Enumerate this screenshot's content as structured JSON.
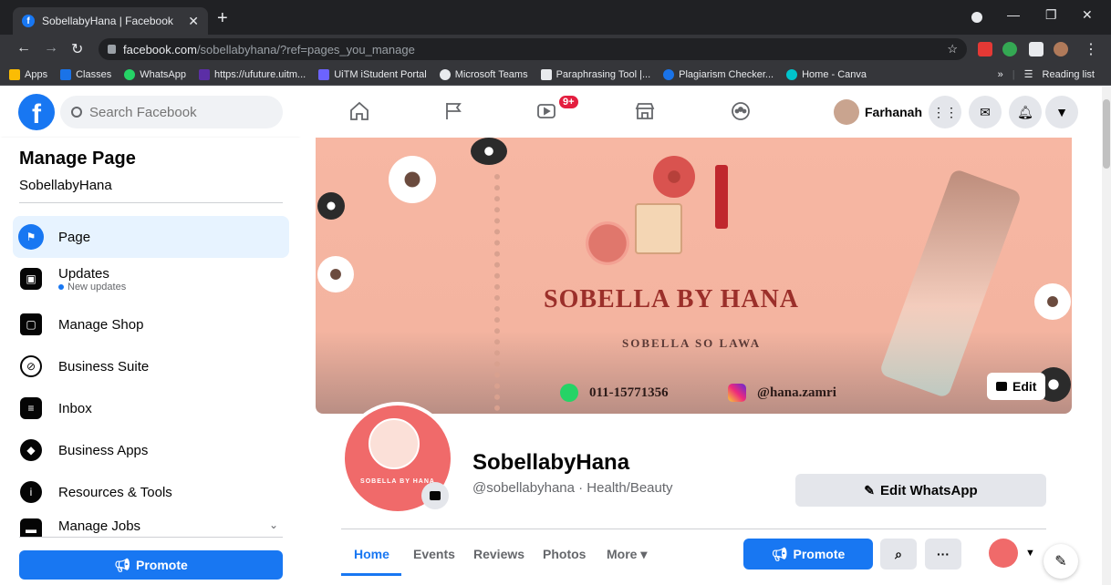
{
  "browser": {
    "tab_title": "SobellabyHana | Facebook",
    "new_tab": "+",
    "url_host": "facebook.com",
    "url_path": "/sobellabyhana/?ref=pages_you_manage",
    "bookmarks": [
      {
        "label": "Apps",
        "color": "#fbbc04"
      },
      {
        "label": "Classes",
        "color": "#1a73e8"
      },
      {
        "label": "WhatsApp",
        "color": "#25d366"
      },
      {
        "label": "https://ufuture.uitm...",
        "color": "#5b2ea6"
      },
      {
        "label": "UiTM iStudent Portal",
        "color": "#6c63ff"
      },
      {
        "label": "Microsoft Teams",
        "color": "#e8eaed"
      },
      {
        "label": "Paraphrasing Tool |...",
        "color": "#e8eaed"
      },
      {
        "label": "Plagiarism Checker...",
        "color": "#1a73e8"
      },
      {
        "label": "Home - Canva",
        "color": "#00c4cc"
      }
    ],
    "overflow": "»",
    "reading_list": "Reading list"
  },
  "fb": {
    "search_placeholder": "Search Facebook",
    "notif_badge": "9+",
    "user_name": "Farhanah"
  },
  "sidebar": {
    "title": "Manage Page",
    "page_name": "SobellabyHana",
    "items": [
      {
        "label": "Page",
        "icon": "flag-icon"
      },
      {
        "label": "Updates",
        "note": "New updates",
        "icon": "updates-icon"
      },
      {
        "label": "Manage Shop",
        "icon": "shop-bag-icon"
      },
      {
        "label": "Business Suite",
        "icon": "business-suite-icon"
      },
      {
        "label": "Inbox",
        "icon": "inbox-icon"
      },
      {
        "label": "Business Apps",
        "icon": "cube-icon"
      },
      {
        "label": "Resources & Tools",
        "icon": "info-icon"
      },
      {
        "label": "Manage Jobs",
        "icon": "briefcase-icon"
      }
    ],
    "promote_label": "Promote"
  },
  "cover": {
    "brand": "SOBELLA BY HANA",
    "tagline": "SOBELLA SO LAWA",
    "phone": "011-15771356",
    "instagram": "@hana.zamri",
    "edit_label": "Edit"
  },
  "profile": {
    "logo_text": "SOBELLA BY HANA",
    "name": "SobellabyHana",
    "subtitle": "@sobellabyhana · Health/Beauty",
    "edit_whatsapp": "Edit WhatsApp"
  },
  "page_tabs": [
    "Home",
    "Events",
    "Reviews",
    "Photos",
    "More ▾"
  ],
  "actions": {
    "promote": "Promote",
    "more": "···"
  },
  "colors": {
    "fb_blue": "#1877f2",
    "cover_peach": "#f4b4a0"
  }
}
